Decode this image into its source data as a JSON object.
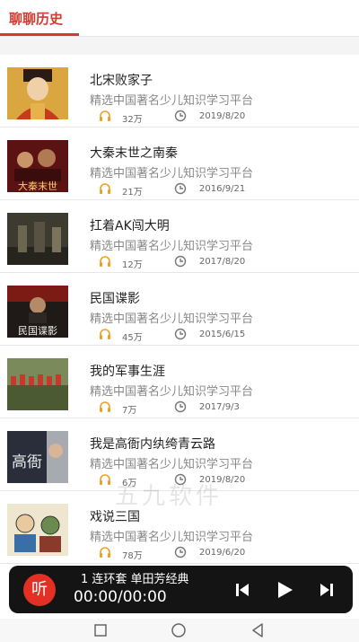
{
  "tab": {
    "label": "聊聊历史"
  },
  "items": [
    {
      "title": "北宋败家子",
      "subtitle": "精选中国著名少儿知识学习平台",
      "plays": "32万",
      "date": "2019/8/20",
      "cover_label": ""
    },
    {
      "title": "大秦末世之南秦",
      "subtitle": "精选中国著名少儿知识学习平台",
      "plays": "21万",
      "date": "2016/9/21",
      "cover_label": "大秦末世"
    },
    {
      "title": "扛着AK闯大明",
      "subtitle": "精选中国著名少儿知识学习平台",
      "plays": "12万",
      "date": "2017/8/20",
      "cover_label": ""
    },
    {
      "title": "民国谍影",
      "subtitle": "精选中国著名少儿知识学习平台",
      "plays": "45万",
      "date": "2015/6/15",
      "cover_label": "民国谍影"
    },
    {
      "title": "我的军事生涯",
      "subtitle": "精选中国著名少儿知识学习平台",
      "plays": "7万",
      "date": "2017/9/3",
      "cover_label": ""
    },
    {
      "title": "我是高衙内纨绔青云路",
      "subtitle": "精选中国著名少儿知识学习平台",
      "plays": "6万",
      "date": "2019/8/20",
      "cover_label": "高衙"
    },
    {
      "title": "戏说三国",
      "subtitle": "精选中国著名少儿知识学习平台",
      "plays": "78万",
      "date": "2019/6/20",
      "cover_label": ""
    }
  ],
  "watermark": "五九软件",
  "player": {
    "logo": "听",
    "track_title": "1 连环套  单田芳经典",
    "time": "00:00/00:00"
  },
  "colors": {
    "accent": "#d23b2f",
    "player_bg": "#141414",
    "icon_orange": "#f0a020"
  }
}
